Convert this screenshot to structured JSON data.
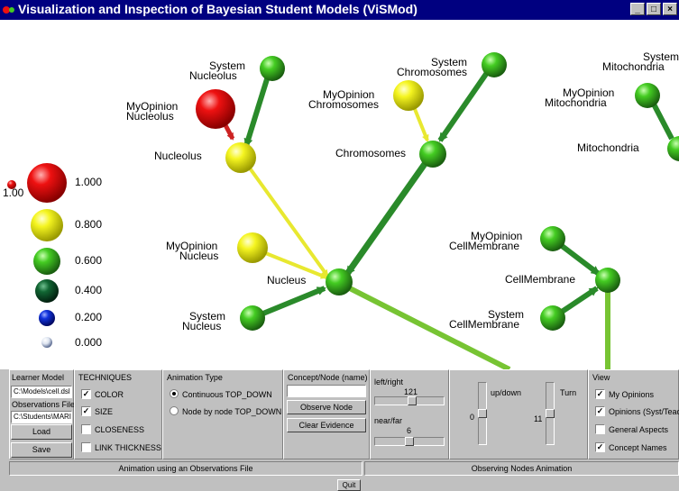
{
  "window": {
    "title": "Visualization and Inspection of Bayesian Student Models (ViSMod)",
    "icon": "app-icon",
    "buttons": [
      "minimize-icon",
      "maximize-icon",
      "close-icon"
    ]
  },
  "colors": {
    "red": "#ee1111",
    "yellow": "#f5f520",
    "green": "#44cc22",
    "dark_green": "#116633",
    "blue": "#1133dd",
    "white_blue": "#dde4f0",
    "yellow_link": "#e8e830",
    "green_link": "#2a8a2a"
  },
  "legend": [
    {
      "value": "1.000",
      "color": "red"
    },
    {
      "value": "0.800",
      "color": "yellow"
    },
    {
      "value": "0.600",
      "color": "green"
    },
    {
      "value": "0.400",
      "color": "dark_green"
    },
    {
      "value": "0.200",
      "color": "blue"
    },
    {
      "value": "0.000",
      "color": "white_blue"
    }
  ],
  "legend_extra_label": "1.00",
  "node_labels": {
    "system_nucleolus": [
      "System",
      "Nucleolus"
    ],
    "myopinion_nucleolus": [
      "MyOpinion",
      "Nucleolus"
    ],
    "nucleolus": "Nucleolus",
    "system_chromosomes": [
      "System",
      "Chromosomes"
    ],
    "myopinion_chromosomes": [
      "MyOpinion",
      "Chromosomes"
    ],
    "chromosomes": "Chromosomes",
    "system_mitochondria": "System",
    "mitochondria_label": "Mitochondria",
    "myopinion_mitochondria": [
      "MyOpinion",
      "Mitochondria"
    ],
    "mitochondria": "Mitochondria",
    "myopinion_nucleus": [
      "MyOpinion",
      "Nucleus"
    ],
    "nucleus": "Nucleus",
    "system_nucleus": [
      "System",
      "Nucleus"
    ],
    "myopinion_cellmembrane": [
      "MyOpinion",
      "CellMembrane"
    ],
    "cellmembrane": "CellMembrane",
    "system_cellmembrane": [
      "System",
      "CellMembrane"
    ]
  },
  "learner_panel": {
    "learner_model_label": "Learner Model",
    "learner_model_value": "C:\\Models\\cell.dsl",
    "observations_file_label": "Observations File",
    "observations_file_value": "C:\\Students\\MARI",
    "load_label": "Load",
    "save_label": "Save"
  },
  "techniques": {
    "title": "TECHNIQUES",
    "items": [
      {
        "label": "COLOR",
        "checked": true
      },
      {
        "label": "SIZE",
        "checked": true
      },
      {
        "label": "CLOSENESS",
        "checked": false
      },
      {
        "label": "LINK THICKNESS",
        "checked": false
      }
    ]
  },
  "animation": {
    "title": "Animation Type",
    "options": [
      {
        "label": "Continuous TOP_DOWN",
        "selected": true
      },
      {
        "label": "Node by node TOP_DOWN",
        "selected": false
      }
    ]
  },
  "concept": {
    "title": "Concept/Node (name)",
    "value": "",
    "observe_label": "Observe Node",
    "clear_label": "Clear Evidence"
  },
  "position": {
    "left_right_label": "left/right",
    "left_right_value": "121",
    "left_right_level": 0.55,
    "near_far_label": "near/far",
    "near_far_value": "6",
    "near_far_level": 0.5
  },
  "rotation": {
    "updown_label": "up/down",
    "updown_value": "0",
    "updown_level": 0.5,
    "turn_label": "Turn",
    "turn_value": "11",
    "turn_level": 0.5
  },
  "view": {
    "title": "View",
    "items": [
      {
        "label": "My Opinions",
        "checked": true
      },
      {
        "label": "Opinions (Syst/Teach)",
        "checked": true
      },
      {
        "label": "General Aspects",
        "checked": false
      },
      {
        "label": "Concept Names",
        "checked": true
      }
    ]
  },
  "status": {
    "left": "Animation using an Observations File",
    "right": "Observing Nodes Animation",
    "quit_label": "Quit"
  }
}
